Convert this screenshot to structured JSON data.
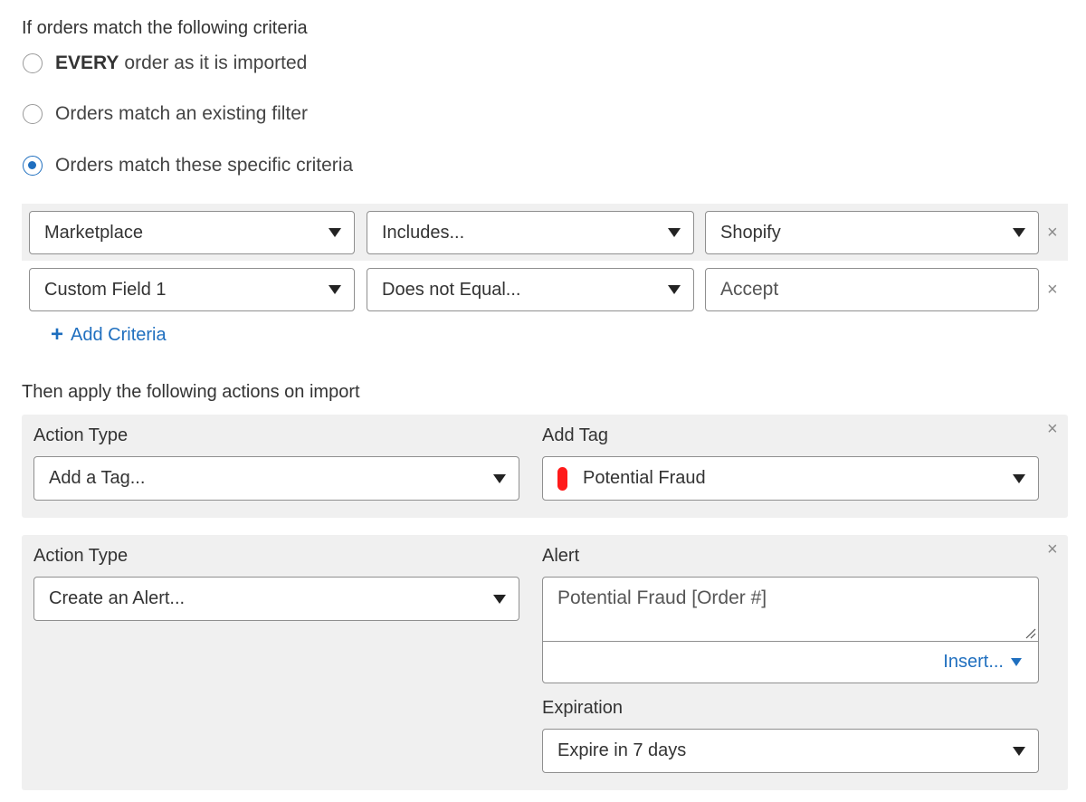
{
  "criteria": {
    "heading": "If orders match the following criteria",
    "options": [
      {
        "bold": "EVERY",
        "label": "order as it is imported",
        "checked": false
      },
      {
        "bold": "",
        "label": "Orders match an existing filter",
        "checked": false
      },
      {
        "bold": "",
        "label": "Orders match these specific criteria",
        "checked": true
      }
    ],
    "rows": [
      {
        "field": "Marketplace",
        "operator": "Includes...",
        "value": "Shopify",
        "value_is_select": true
      },
      {
        "field": "Custom Field 1",
        "operator": "Does not Equal...",
        "value": "Accept",
        "value_is_select": false
      }
    ],
    "add_criteria_label": "Add Criteria"
  },
  "actions": {
    "heading": "Then apply the following actions on import",
    "items": [
      {
        "type_label": "Action Type",
        "type_value": "Add a Tag...",
        "detail_label": "Add Tag",
        "tag_name": "Potential Fraud",
        "tag_color": "#ff1a1a"
      },
      {
        "type_label": "Action Type",
        "type_value": "Create an Alert...",
        "detail_label": "Alert",
        "alert_text": "Potential Fraud [Order #]",
        "insert_label": "Insert...",
        "expiration_label": "Expiration",
        "expiration_value": "Expire in 7 days"
      }
    ]
  },
  "icons": {
    "remove": "×",
    "plus": "+",
    "remove_icon_name": "close-icon",
    "dropdown_icon_name": "chevron-down-icon"
  },
  "colors": {
    "accent": "#1f6fbf",
    "band_bg": "#f0f0f0",
    "tag_red": "#ff1a1a"
  }
}
